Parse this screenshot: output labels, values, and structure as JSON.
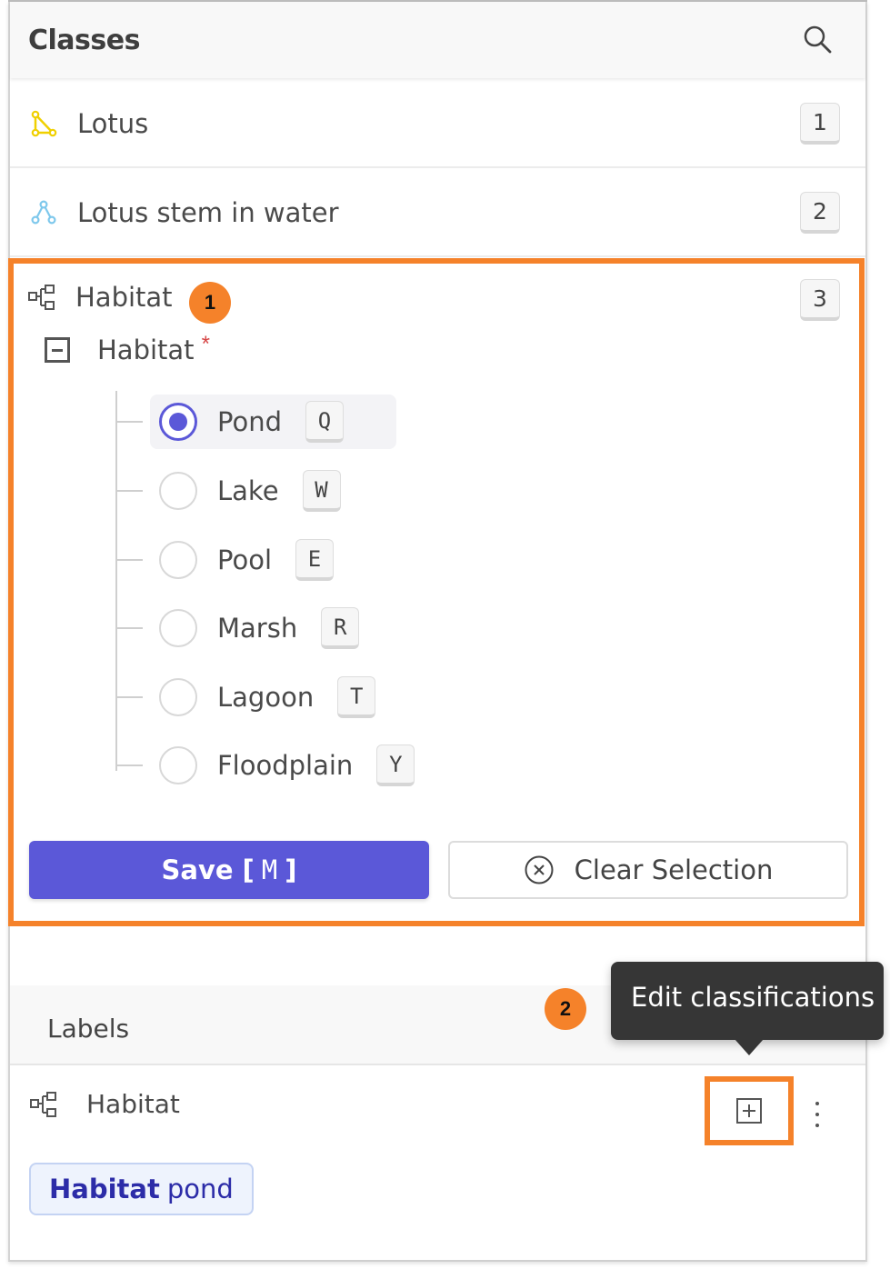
{
  "classes_panel": {
    "title": "Classes",
    "items": [
      {
        "name": "Lotus",
        "hotkey": "1",
        "icon": "polygon-icon",
        "icon_color": "#f0d000"
      },
      {
        "name": "Lotus stem in water",
        "hotkey": "2",
        "icon": "keypoint-skeleton-icon",
        "icon_color": "#7ec8ec"
      },
      {
        "name": "Habitat",
        "hotkey": "3",
        "icon": "classification-tree-icon",
        "icon_color": "#555555"
      }
    ]
  },
  "classification_editor": {
    "callout": "1",
    "question_label": "Habitat",
    "required_marker": "*",
    "options": [
      {
        "label": "Pond",
        "key": "Q",
        "selected": true
      },
      {
        "label": "Lake",
        "key": "W",
        "selected": false
      },
      {
        "label": "Pool",
        "key": "E",
        "selected": false
      },
      {
        "label": "Marsh",
        "key": "R",
        "selected": false
      },
      {
        "label": "Lagoon",
        "key": "T",
        "selected": false
      },
      {
        "label": "Floodplain",
        "key": "Y",
        "selected": false
      }
    ],
    "save_label": "Save",
    "save_bracket_open": "[",
    "save_key": "M",
    "save_bracket_close": "]",
    "clear_label": "Clear Selection"
  },
  "labels_panel": {
    "title": "Labels",
    "callout": "2",
    "tooltip": "Edit classifications",
    "row_title": "Habitat",
    "tag_key": "Habitat",
    "tag_value": "pond"
  },
  "colors": {
    "accent": "#5b58d8",
    "highlight": "#f5822a",
    "tag_bg": "#eef3fd",
    "tag_text": "#2c2ca8"
  }
}
